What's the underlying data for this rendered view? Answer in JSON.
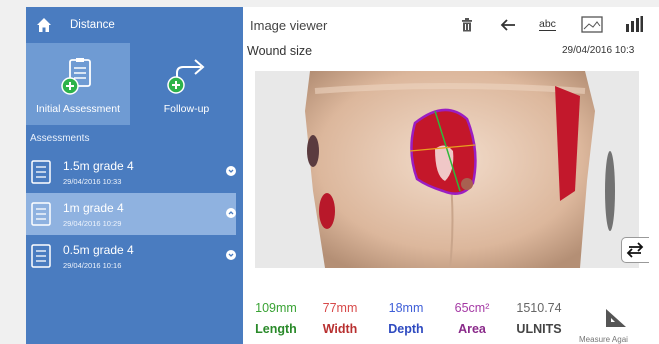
{
  "sidebar": {
    "title": "Distance",
    "actions": [
      {
        "label": "Initial Assessment",
        "icon": "add-assessment-icon"
      },
      {
        "label": "Follow-up",
        "icon": "follow-up-icon"
      }
    ],
    "section_title": "Assessments",
    "assessments": [
      {
        "title": "1.5m grade 4",
        "date": "29/04/2016 10:33",
        "expanded": false
      },
      {
        "title": "1m grade 4",
        "date": "29/04/2016 10:29",
        "expanded": true
      },
      {
        "title": "0.5m grade 4",
        "date": "29/04/2016 10:16",
        "expanded": false
      }
    ]
  },
  "viewer": {
    "title": "Image viewer",
    "toolbar": [
      "trash-icon",
      "back-arrow-icon",
      "abc-label-icon",
      "image-icon",
      "bar-chart-icon"
    ],
    "abc_label": "abc",
    "subtitle": "Wound size",
    "date": "29/04/2016 10:3"
  },
  "metrics": [
    {
      "value": "109mm",
      "label": "Length",
      "value_color": "#3aa335",
      "label_color": "#2a8a2a"
    },
    {
      "value": "77mm",
      "label": "Width",
      "value_color": "#d84a4a",
      "label_color": "#b83030"
    },
    {
      "value": "18mm",
      "label": "Depth",
      "value_color": "#3f5fd8",
      "label_color": "#2e4ac0"
    },
    {
      "value": "65cm²",
      "label": "Area",
      "value_color": "#a53aa5",
      "label_color": "#8a2a8a"
    },
    {
      "value": "1510.74",
      "label": "ULNITS",
      "value_color": "#666666",
      "label_color": "#444444"
    }
  ],
  "measure_label": "Measure Agai",
  "colors": {
    "sidebar": "#4a7cc0",
    "sidebar_active": "#6f9bd3",
    "selected_row": "#8fb2e0",
    "add_badge": "#2db34a"
  }
}
